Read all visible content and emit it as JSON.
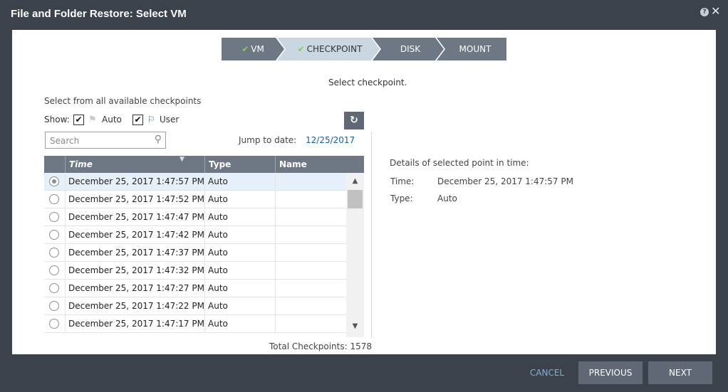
{
  "window": {
    "title": "File and Folder Restore: Select VM",
    "help_icon": "?",
    "close_icon": "✕"
  },
  "steps": [
    {
      "label": "VM",
      "done": true
    },
    {
      "label": "CHECKPOINT",
      "done": true,
      "active": true
    },
    {
      "label": "DISK",
      "done": false
    },
    {
      "label": "MOUNT",
      "done": false
    }
  ],
  "instruction": "Select checkpoint.",
  "subheading": "Select from all available checkpoints",
  "filters": {
    "show_label": "Show:",
    "auto_label": "Auto",
    "auto_checked": true,
    "user_label": "User",
    "user_checked": true
  },
  "search": {
    "placeholder": "Search",
    "value": ""
  },
  "jump": {
    "label": "Jump to date:",
    "date": "12/25/2017"
  },
  "table": {
    "columns": [
      "Time",
      "Type",
      "Name"
    ],
    "rows": [
      {
        "time": "December 25, 2017 1:47:57 PM",
        "type": "Auto",
        "name": "",
        "selected": true
      },
      {
        "time": "December 25, 2017 1:47:52 PM",
        "type": "Auto",
        "name": ""
      },
      {
        "time": "December 25, 2017 1:47:47 PM",
        "type": "Auto",
        "name": ""
      },
      {
        "time": "December 25, 2017 1:47:42 PM",
        "type": "Auto",
        "name": ""
      },
      {
        "time": "December 25, 2017 1:47:37 PM",
        "type": "Auto",
        "name": ""
      },
      {
        "time": "December 25, 2017 1:47:32 PM",
        "type": "Auto",
        "name": ""
      },
      {
        "time": "December 25, 2017 1:47:27 PM",
        "type": "Auto",
        "name": ""
      },
      {
        "time": "December 25, 2017 1:47:22 PM",
        "type": "Auto",
        "name": ""
      },
      {
        "time": "December 25, 2017 1:47:17 PM",
        "type": "Auto",
        "name": ""
      }
    ]
  },
  "total": "Total Checkpoints: 1578",
  "details": {
    "title": "Details of selected point in time:",
    "time_label": "Time:",
    "time_value": "December 25, 2017 1:47:57 PM",
    "type_label": "Type:",
    "type_value": "Auto"
  },
  "footer": {
    "cancel": "CANCEL",
    "previous": "PREVIOUS",
    "next": "NEXT"
  },
  "colors": {
    "chrome": "#3c424b",
    "step_inactive": "#6e7884",
    "step_active": "#c9d7e3",
    "check": "#7fd147",
    "link": "#1b5e9b",
    "cancel": "#7fb0d6"
  }
}
